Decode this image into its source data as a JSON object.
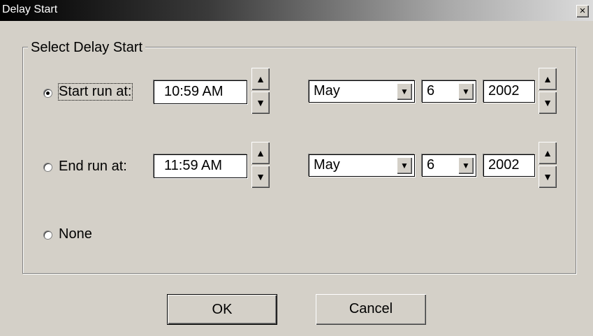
{
  "window": {
    "title": "Delay Start",
    "close_glyph": "×"
  },
  "group": {
    "title": "Select Delay Start"
  },
  "options": {
    "start": {
      "label": "Start run at:",
      "selected": true,
      "time": "10:59 AM",
      "month": "May",
      "day": "6",
      "year": "2002"
    },
    "end": {
      "label": "End run at:",
      "selected": false,
      "time": "11:59 AM",
      "month": "May",
      "day": "6",
      "year": "2002"
    },
    "none": {
      "label": "None",
      "selected": false
    }
  },
  "buttons": {
    "ok": "OK",
    "cancel": "Cancel"
  },
  "icons": {
    "spin_up": "▲",
    "spin_down": "▼",
    "dropdown": "▼"
  }
}
